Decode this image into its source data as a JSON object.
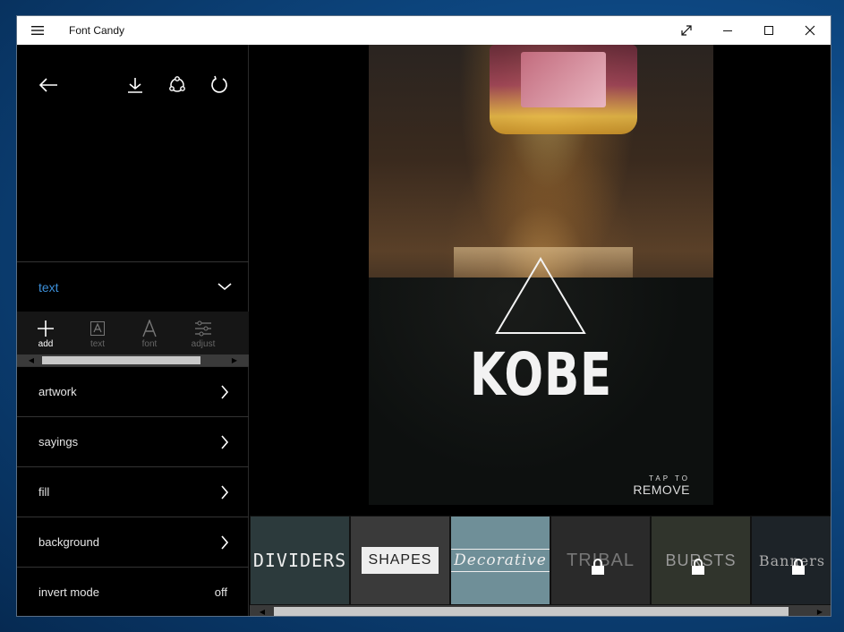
{
  "window": {
    "title": "Font Candy"
  },
  "sidebar": {
    "section_label": "text",
    "tools": [
      {
        "label": "add",
        "icon": "plus-icon"
      },
      {
        "label": "text",
        "icon": "text-box-icon"
      },
      {
        "label": "font",
        "icon": "font-icon"
      },
      {
        "label": "adjust",
        "icon": "sliders-icon"
      }
    ],
    "menu": [
      {
        "label": "artwork"
      },
      {
        "label": "sayings"
      },
      {
        "label": "fill"
      },
      {
        "label": "background"
      },
      {
        "label": "invert mode",
        "value": "off"
      }
    ]
  },
  "canvas": {
    "headline": "KOBE",
    "tap_hint_small": "TAP TO",
    "tap_hint_large": "REMOVE"
  },
  "gallery": {
    "tiles": [
      {
        "label": "DIVIDERS",
        "locked": false,
        "color": "#2c3a3c"
      },
      {
        "label": "SHAPES",
        "locked": false,
        "color": "#3a3a3a"
      },
      {
        "label": "Decorative",
        "locked": false,
        "color": "#6f8f98"
      },
      {
        "label": "TRIBAL",
        "locked": true,
        "color": "#2a2a2a"
      },
      {
        "label": "BURSTS",
        "locked": true,
        "color": "#30342c"
      },
      {
        "label": "Banners",
        "locked": true,
        "color": "#1d2328"
      }
    ]
  },
  "colors": {
    "accent": "#3c8fd9",
    "background": "#000000"
  }
}
